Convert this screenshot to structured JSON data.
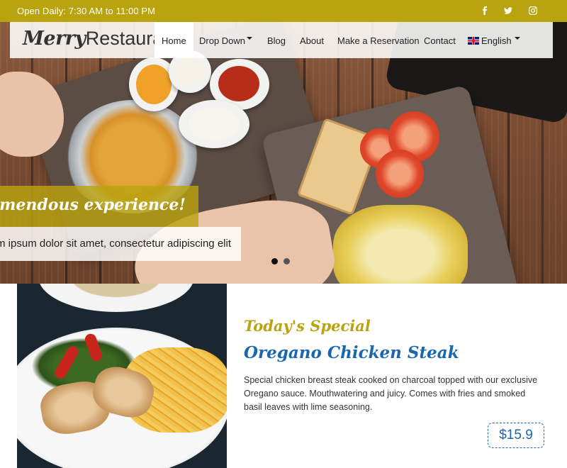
{
  "topbar": {
    "hours": "Open Daily: 7:30 AM to 11:00 PM",
    "social": [
      {
        "icon": "facebook-icon"
      },
      {
        "icon": "twitter-icon"
      },
      {
        "icon": "instagram-icon"
      }
    ]
  },
  "brand": {
    "logo_merry": "Merry",
    "logo_restaurant": "Restaurant"
  },
  "nav": {
    "items": [
      {
        "label": "Home",
        "active": true
      },
      {
        "label": "Drop Down",
        "has_dropdown": true
      },
      {
        "label": "Blog"
      },
      {
        "label": "About"
      },
      {
        "label": "Make a Reservation"
      },
      {
        "label": "Contact"
      }
    ],
    "language": {
      "label": "English",
      "flag_icon": "uk-flag-icon"
    }
  },
  "hero": {
    "caption_title": "ve a tremendous experience!",
    "caption_text": "m ipsum dolor sit amet, consectetur adipiscing elit",
    "slides_total": 2,
    "slide_active": 1
  },
  "special": {
    "heading": "Today's Special",
    "name": "Oregano Chicken Steak",
    "description": "Special chicken breast steak cooked on charcoal topped with our exclusive Oregano sauce. Mouthwatering and juicy. Comes with fries and smoked basil leaves with lime seasoning.",
    "price": "$15.9"
  },
  "colors": {
    "accent_gold": "#b9a40f",
    "accent_blue": "#1a67b0"
  }
}
